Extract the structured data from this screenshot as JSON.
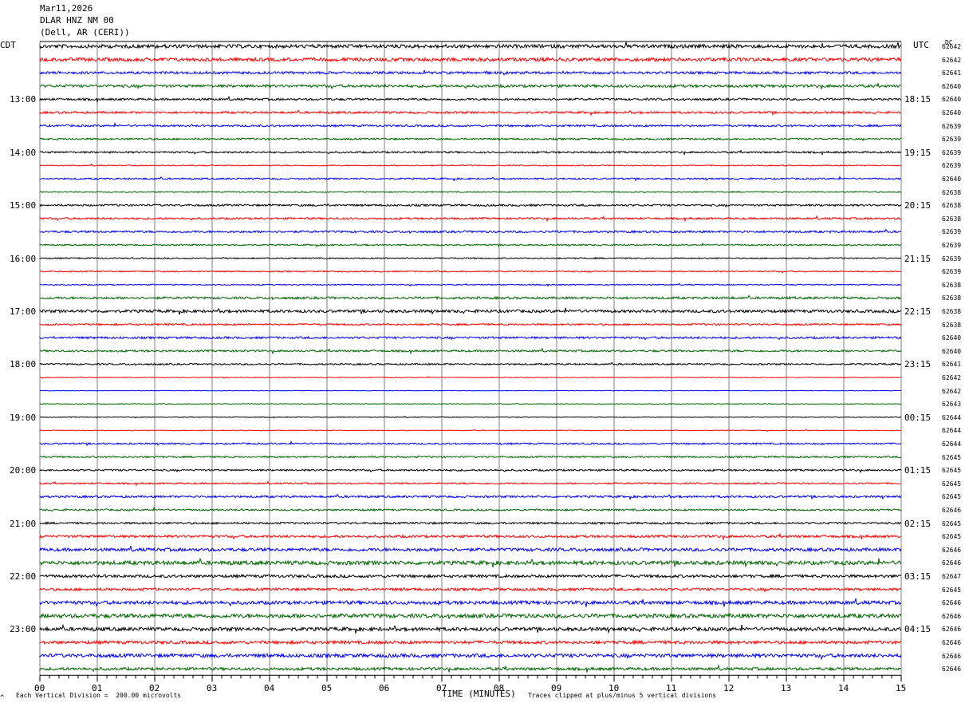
{
  "header": {
    "date": "Mar11,2026",
    "station": "DLAR HNZ NM 00",
    "location": "(Dell, AR (CERI))"
  },
  "left_timezone": "CDT",
  "right_timezone": "UTC",
  "dc_label": "DC",
  "footer": {
    "scale_note": "Each Vertical Division =  200.00 microvolts",
    "xlabel": "TIME (MINUTES)",
    "clip_note": "Traces clipped at plus/minus 5 vertical divisions"
  },
  "colors": [
    "#000000",
    "#ff0000",
    "#0000ff",
    "#006400"
  ],
  "chart_data": {
    "type": "line",
    "xlabel": "TIME (MINUTES)",
    "x_ticks": [
      "00",
      "01",
      "02",
      "03",
      "04",
      "05",
      "06",
      "07",
      "08",
      "09",
      "10",
      "11",
      "12",
      "13",
      "14",
      "15"
    ],
    "xlim": [
      0,
      15
    ],
    "row_minutes": 15,
    "rows": 48,
    "left_hour_labels": [
      "13:00",
      "14:00",
      "15:00",
      "16:00",
      "17:00",
      "18:00",
      "19:00",
      "20:00",
      "21:00",
      "22:00",
      "23:00"
    ],
    "right_hour_labels": [
      "18:15",
      "19:15",
      "20:15",
      "21:15",
      "22:15",
      "23:15",
      "00:15",
      "01:15",
      "02:15",
      "03:15",
      "04:15"
    ],
    "dc_offsets": [
      62642,
      62642,
      62641,
      62640,
      62640,
      62640,
      62639,
      62639,
      62639,
      62639,
      62640,
      62638,
      62638,
      62638,
      62639,
      62639,
      62639,
      62639,
      62638,
      62638,
      62638,
      62638,
      62640,
      62640,
      62641,
      62642,
      62642,
      62643,
      62644,
      62644,
      62644,
      62645,
      62645,
      62645,
      62645,
      62646,
      62645,
      62645,
      62646,
      62646,
      62647,
      62645,
      62646,
      62646,
      62646,
      62646,
      62646,
      62646
    ],
    "amplitudes": [
      1.0,
      1.0,
      0.7,
      0.75,
      0.6,
      0.6,
      0.55,
      0.5,
      0.5,
      0.3,
      0.45,
      0.3,
      0.55,
      0.55,
      0.6,
      0.4,
      0.35,
      0.35,
      0.3,
      0.65,
      0.8,
      0.5,
      0.6,
      0.55,
      0.45,
      0.2,
      0.15,
      0.2,
      0.2,
      0.2,
      0.45,
      0.45,
      0.5,
      0.45,
      0.6,
      0.5,
      0.55,
      0.7,
      0.9,
      1.1,
      0.8,
      0.75,
      1.0,
      1.1,
      1.0,
      0.9,
      1.0,
      0.8
    ]
  }
}
